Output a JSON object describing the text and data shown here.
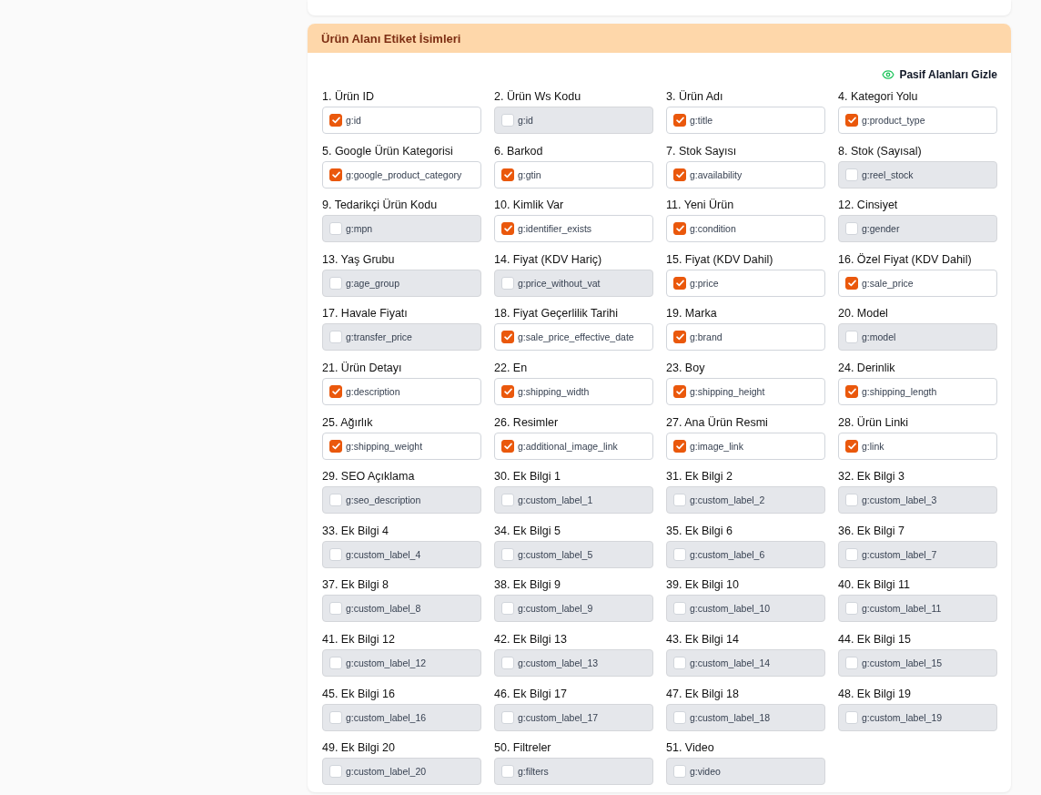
{
  "section": {
    "title": "Ürün Alanı Etiket İsimleri",
    "toggle_button": {
      "label": "Pasif Alanları Gizle"
    },
    "fields": [
      {
        "label": "1. Ürün ID",
        "value": "g:id",
        "checked": true
      },
      {
        "label": "2. Ürün Ws Kodu",
        "value": "g:id",
        "checked": false
      },
      {
        "label": "3. Ürün Adı",
        "value": "g:title",
        "checked": true
      },
      {
        "label": "4. Kategori Yolu",
        "value": "g:product_type",
        "checked": true
      },
      {
        "label": "5. Google Ürün Kategorisi",
        "value": "g:google_product_category",
        "checked": true
      },
      {
        "label": "6. Barkod",
        "value": "g:gtin",
        "checked": true
      },
      {
        "label": "7. Stok Sayısı",
        "value": "g:availability",
        "checked": true
      },
      {
        "label": "8. Stok (Sayısal)",
        "value": "g:reel_stock",
        "checked": false
      },
      {
        "label": "9. Tedarikçi Ürün Kodu",
        "value": "g:mpn",
        "checked": false
      },
      {
        "label": "10. Kimlik Var",
        "value": "g:identifier_exists",
        "checked": true
      },
      {
        "label": "11. Yeni Ürün",
        "value": "g:condition",
        "checked": true
      },
      {
        "label": "12. Cinsiyet",
        "value": "g:gender",
        "checked": false
      },
      {
        "label": "13. Yaş Grubu",
        "value": "g:age_group",
        "checked": false
      },
      {
        "label": "14. Fiyat (KDV Hariç)",
        "value": "g:price_without_vat",
        "checked": false
      },
      {
        "label": "15. Fiyat (KDV Dahil)",
        "value": "g:price",
        "checked": true
      },
      {
        "label": "16. Özel Fiyat (KDV Dahil)",
        "value": "g:sale_price",
        "checked": true
      },
      {
        "label": "17. Havale Fiyatı",
        "value": "g:transfer_price",
        "checked": false
      },
      {
        "label": "18. Fiyat Geçerlilik Tarihi",
        "value": "g:sale_price_effective_date",
        "checked": true
      },
      {
        "label": "19. Marka",
        "value": "g:brand",
        "checked": true
      },
      {
        "label": "20. Model",
        "value": "g:model",
        "checked": false
      },
      {
        "label": "21. Ürün Detayı",
        "value": "g:description",
        "checked": true
      },
      {
        "label": "22. En",
        "value": "g:shipping_width",
        "checked": true
      },
      {
        "label": "23. Boy",
        "value": "g:shipping_height",
        "checked": true
      },
      {
        "label": "24. Derinlik",
        "value": "g:shipping_length",
        "checked": true
      },
      {
        "label": "25. Ağırlık",
        "value": "g:shipping_weight",
        "checked": true
      },
      {
        "label": "26. Resimler",
        "value": "g:additional_image_link",
        "checked": true
      },
      {
        "label": "27. Ana Ürün Resmi",
        "value": "g:image_link",
        "checked": true
      },
      {
        "label": "28. Ürün Linki",
        "value": "g:link",
        "checked": true
      },
      {
        "label": "29. SEO Açıklama",
        "value": "g:seo_description",
        "checked": false
      },
      {
        "label": "30. Ek Bilgi 1",
        "value": "g:custom_label_1",
        "checked": false
      },
      {
        "label": "31. Ek Bilgi 2",
        "value": "g:custom_label_2",
        "checked": false
      },
      {
        "label": "32. Ek Bilgi 3",
        "value": "g:custom_label_3",
        "checked": false
      },
      {
        "label": "33. Ek Bilgi 4",
        "value": "g:custom_label_4",
        "checked": false
      },
      {
        "label": "34. Ek Bilgi 5",
        "value": "g:custom_label_5",
        "checked": false
      },
      {
        "label": "35. Ek Bilgi 6",
        "value": "g:custom_label_6",
        "checked": false
      },
      {
        "label": "36. Ek Bilgi 7",
        "value": "g:custom_label_7",
        "checked": false
      },
      {
        "label": "37. Ek Bilgi 8",
        "value": "g:custom_label_8",
        "checked": false
      },
      {
        "label": "38. Ek Bilgi 9",
        "value": "g:custom_label_9",
        "checked": false
      },
      {
        "label": "39. Ek Bilgi 10",
        "value": "g:custom_label_10",
        "checked": false
      },
      {
        "label": "40. Ek Bilgi 11",
        "value": "g:custom_label_11",
        "checked": false
      },
      {
        "label": "41. Ek Bilgi 12",
        "value": "g:custom_label_12",
        "checked": false
      },
      {
        "label": "42. Ek Bilgi 13",
        "value": "g:custom_label_13",
        "checked": false
      },
      {
        "label": "43. Ek Bilgi 14",
        "value": "g:custom_label_14",
        "checked": false
      },
      {
        "label": "44. Ek Bilgi 15",
        "value": "g:custom_label_15",
        "checked": false
      },
      {
        "label": "45. Ek Bilgi 16",
        "value": "g:custom_label_16",
        "checked": false
      },
      {
        "label": "46. Ek Bilgi 17",
        "value": "g:custom_label_17",
        "checked": false
      },
      {
        "label": "47. Ek Bilgi 18",
        "value": "g:custom_label_18",
        "checked": false
      },
      {
        "label": "48. Ek Bilgi 19",
        "value": "g:custom_label_19",
        "checked": false
      },
      {
        "label": "49. Ek Bilgi 20",
        "value": "g:custom_label_20",
        "checked": false
      },
      {
        "label": "50. Filtreler",
        "value": "g:filters",
        "checked": false
      },
      {
        "label": "51. Video",
        "value": "g:video",
        "checked": false
      }
    ]
  }
}
